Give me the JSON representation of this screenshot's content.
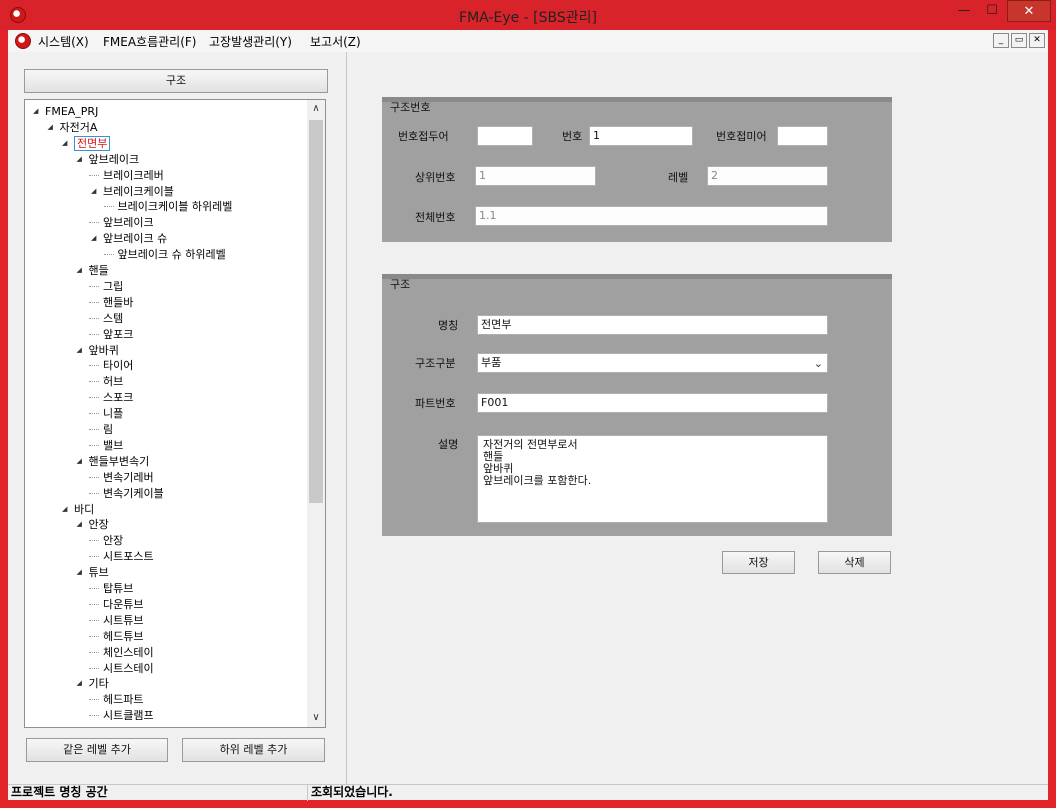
{
  "window": {
    "title": "FMA-Eye - [SBS관리]",
    "min_glyph": "—",
    "max_glyph": "☐",
    "close_glyph": "✕",
    "accent": "#d9232b"
  },
  "menu": {
    "items": [
      "시스템(X)",
      "FMEA흐름관리(F)",
      "고장발생관리(Y)",
      "보고서(Z)"
    ],
    "mdi_min": "_",
    "mdi_restore": "▭",
    "mdi_close": "✕"
  },
  "left": {
    "header_button": "구조",
    "add_same_level": "같은 레벨 추가",
    "add_sub_level": "하위 레벨 추가"
  },
  "tree": {
    "nodes": [
      {
        "label": "FMEA_PRJ",
        "depth": 0,
        "expand": "◢"
      },
      {
        "label": "자전거A",
        "depth": 1,
        "expand": "◢"
      },
      {
        "label": "전면부",
        "depth": 2,
        "expand": "◢",
        "selected": true
      },
      {
        "label": "앞브레이크",
        "depth": 3,
        "expand": "◢"
      },
      {
        "label": "브레이크레버",
        "depth": 4,
        "expand": ""
      },
      {
        "label": "브레이크케이블",
        "depth": 4,
        "expand": "◢"
      },
      {
        "label": "브레이크케이블 하위레벨",
        "depth": 5,
        "expand": ""
      },
      {
        "label": "앞브레이크",
        "depth": 4,
        "expand": ""
      },
      {
        "label": "앞브레이크 슈",
        "depth": 4,
        "expand": "◢"
      },
      {
        "label": "앞브레이크 슈 하위레벨",
        "depth": 5,
        "expand": ""
      },
      {
        "label": "핸들",
        "depth": 3,
        "expand": "◢"
      },
      {
        "label": "그립",
        "depth": 4,
        "expand": ""
      },
      {
        "label": "핸들바",
        "depth": 4,
        "expand": ""
      },
      {
        "label": "스템",
        "depth": 4,
        "expand": ""
      },
      {
        "label": "앞포크",
        "depth": 4,
        "expand": ""
      },
      {
        "label": "앞바퀴",
        "depth": 3,
        "expand": "◢"
      },
      {
        "label": "타이어",
        "depth": 4,
        "expand": ""
      },
      {
        "label": "허브",
        "depth": 4,
        "expand": ""
      },
      {
        "label": "스포크",
        "depth": 4,
        "expand": ""
      },
      {
        "label": "니플",
        "depth": 4,
        "expand": ""
      },
      {
        "label": "림",
        "depth": 4,
        "expand": ""
      },
      {
        "label": "밸브",
        "depth": 4,
        "expand": ""
      },
      {
        "label": "핸들부변속기",
        "depth": 3,
        "expand": "◢"
      },
      {
        "label": "변속기레버",
        "depth": 4,
        "expand": ""
      },
      {
        "label": "변속기케이블",
        "depth": 4,
        "expand": ""
      },
      {
        "label": "바디",
        "depth": 2,
        "expand": "◢"
      },
      {
        "label": "안장",
        "depth": 3,
        "expand": "◢"
      },
      {
        "label": "안장",
        "depth": 4,
        "expand": ""
      },
      {
        "label": "시트포스트",
        "depth": 4,
        "expand": ""
      },
      {
        "label": "튜브",
        "depth": 3,
        "expand": "◢"
      },
      {
        "label": "탑튜브",
        "depth": 4,
        "expand": ""
      },
      {
        "label": "다운튜브",
        "depth": 4,
        "expand": ""
      },
      {
        "label": "시트튜브",
        "depth": 4,
        "expand": ""
      },
      {
        "label": "헤드튜브",
        "depth": 4,
        "expand": ""
      },
      {
        "label": "체인스테이",
        "depth": 4,
        "expand": ""
      },
      {
        "label": "시트스테이",
        "depth": 4,
        "expand": ""
      },
      {
        "label": "기타",
        "depth": 3,
        "expand": "◢"
      },
      {
        "label": "헤드파트",
        "depth": 4,
        "expand": ""
      },
      {
        "label": "시트클램프",
        "depth": 4,
        "expand": ""
      }
    ],
    "scroll_up": "∧",
    "scroll_down": "∨"
  },
  "structure_number": {
    "title": "구조번호",
    "prefix_label": "번호접두어",
    "prefix_value": "",
    "number_label": "번호",
    "number_value": "1",
    "suffix_label": "번호접미어",
    "suffix_value": "",
    "parent_label": "상위번호",
    "parent_value": "1",
    "level_label": "레벨",
    "level_value": "2",
    "full_label": "전체번호",
    "full_value": "1.1"
  },
  "structure": {
    "title": "구조",
    "name_label": "명칭",
    "name_value": "전면부",
    "type_label": "구조구분",
    "type_value": "부품",
    "part_label": "파트번호",
    "part_value": "F001",
    "desc_label": "설명",
    "desc_value": "자전거의 전면부로서\n핸들\n앞바퀴\n앞브레이크를 포함한다."
  },
  "actions": {
    "save": "저장",
    "delete": "삭제"
  },
  "status": {
    "left": "프로젝트 명칭 공간",
    "right": "조회되었습니다."
  }
}
